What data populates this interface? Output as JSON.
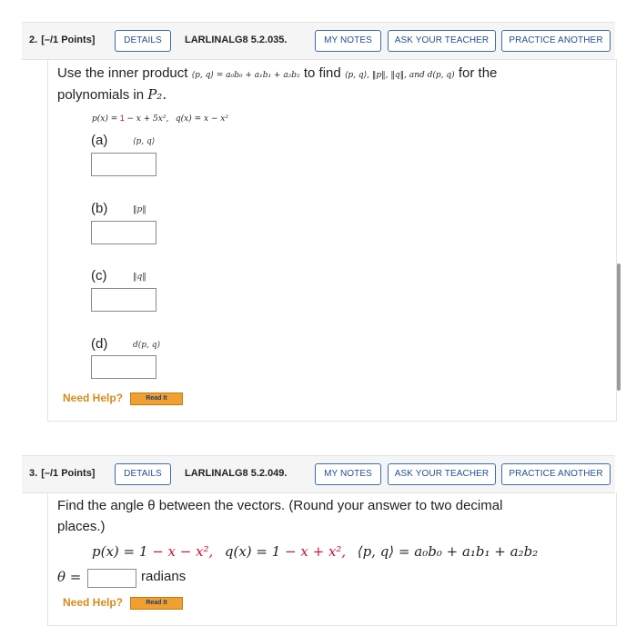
{
  "q2": {
    "number": "2.",
    "points": "[–/1 Points]",
    "details": "DETAILS",
    "code": "LARLINALG8 5.2.035.",
    "my_notes": "MY NOTES",
    "ask_teacher": "ASK YOUR TEACHER",
    "practice": "PRACTICE ANOTHER",
    "intro_a": "Use the inner product",
    "inner_product": "⟨p, q⟩ = a₀b₀ + a₁b₁ + a₂b₂",
    "intro_b": "to find",
    "find_list": "⟨p, q⟩, ‖p‖, ‖q‖, and d(p, q)",
    "intro_c": "for the",
    "line2": "polynomials in",
    "space": "P₂.",
    "p_lhs": "p(x) =",
    "p_rhs_red": "1",
    "p_rest": "− x + 5x²,",
    "q_def": "q(x) = x − x²",
    "parts": [
      {
        "label": "(a)",
        "expr": "⟨p, q⟩"
      },
      {
        "label": "(b)",
        "expr": "‖p‖"
      },
      {
        "label": "(c)",
        "expr": "‖q‖"
      },
      {
        "label": "(d)",
        "expr": "d(p, q)"
      }
    ],
    "need_help": "Need Help?",
    "read_it": "Read It"
  },
  "q3": {
    "number": "3.",
    "points": "[–/1 Points]",
    "details": "DETAILS",
    "code": "LARLINALG8 5.2.049.",
    "my_notes": "MY NOTES",
    "ask_teacher": "ASK YOUR TEACHER",
    "practice": "PRACTICE ANOTHER",
    "line1": "Find the angle θ between the vectors. (Round your answer to two decimal",
    "line2": "places.)",
    "p_def_a": "p(x) = 1 ",
    "p_def_red": "− x − x²,",
    "q_def_a": "q(x) = 1 ",
    "q_def_red": "− x + x²,",
    "ip_def": "⟨p, q⟩ = a₀b₀ + a₁b₁ + a₂b₂",
    "theta": "θ =",
    "unit": "radians",
    "need_help": "Need Help?",
    "read_it": "Read It"
  }
}
